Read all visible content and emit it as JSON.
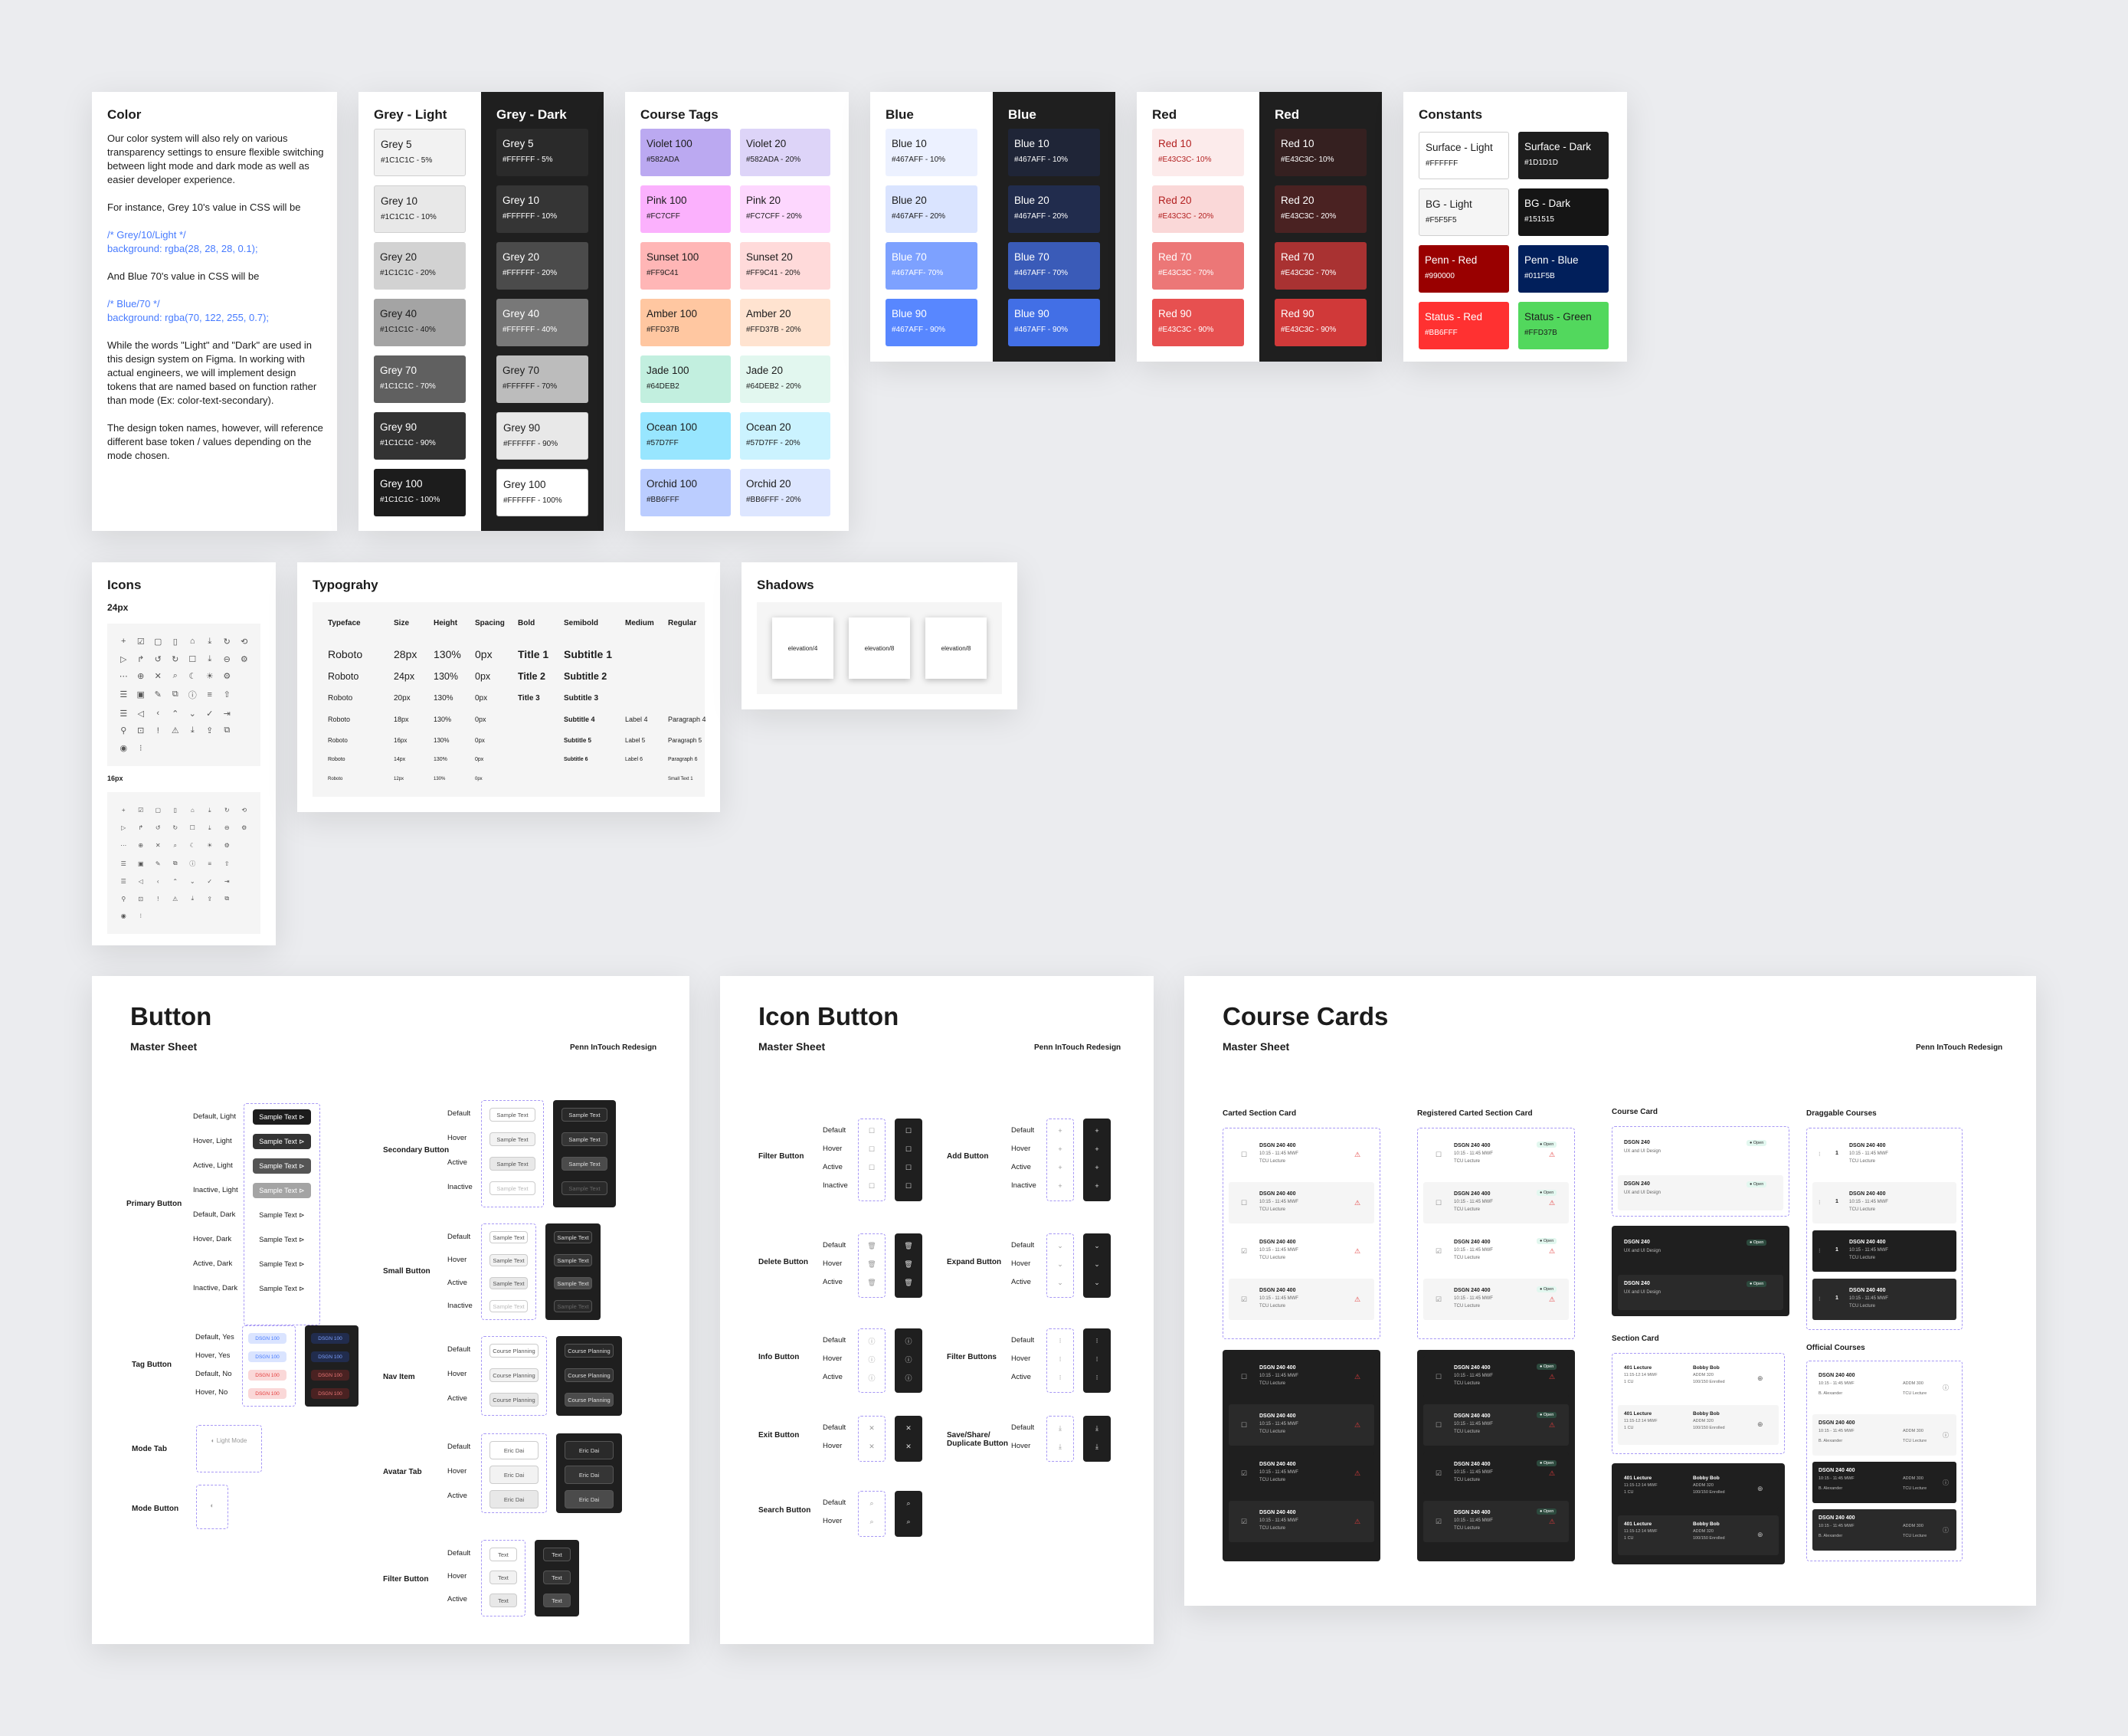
{
  "color_panel": {
    "title": "Color",
    "p1": "Our color system will also rely on various transparency settings to ensure flexible switching between light mode and dark mode as well as easier developer experience.",
    "p2": "For instance, Grey 10's value in CSS will be",
    "code1a": "/* Grey/10/Light */",
    "code1b": "background: rgba(28, 28, 28, 0.1);",
    "p3": "And Blue 70's value in CSS will be",
    "code2a": "/* Blue/70 */",
    "code2b": "background: rgba(70, 122, 255, 0.7);",
    "p4": "While the words \"Light\" and \"Dark\" are used in this design system on Figma. In working with actual engineers, we will implement design tokens that are named based on function rather than mode (Ex: color-text-secondary).",
    "p5": "The design token names, however, will reference different base token / values depending on the mode chosen."
  },
  "grey_light": {
    "title": "Grey - Light",
    "items": [
      {
        "n": "Grey 5",
        "v": "#1C1C1C - 5%",
        "bg": "#f2f2f2",
        "fg": "#1c1c1c"
      },
      {
        "n": "Grey 10",
        "v": "#1C1C1C - 10%",
        "bg": "#e8e8e8",
        "fg": "#1c1c1c"
      },
      {
        "n": "Grey 20",
        "v": "#1C1C1C - 20%",
        "bg": "#d2d2d2",
        "fg": "#1c1c1c"
      },
      {
        "n": "Grey 40",
        "v": "#1C1C1C - 40%",
        "bg": "#a4a4a4",
        "fg": "#1c1c1c"
      },
      {
        "n": "Grey 70",
        "v": "#1C1C1C - 70%",
        "bg": "#606060",
        "fg": "#ffffff"
      },
      {
        "n": "Grey 90",
        "v": "#1C1C1C - 90%",
        "bg": "#333333",
        "fg": "#ffffff"
      },
      {
        "n": "Grey 100",
        "v": "#1C1C1C - 100%",
        "bg": "#1c1c1c",
        "fg": "#ffffff"
      }
    ]
  },
  "grey_dark": {
    "title": "Grey - Dark",
    "items": [
      {
        "n": "Grey 5",
        "v": "#FFFFFF - 5%",
        "bg": "#2a2a2a",
        "fg": "#ffffff"
      },
      {
        "n": "Grey 10",
        "v": "#FFFFFF - 10%",
        "bg": "#353535",
        "fg": "#ffffff"
      },
      {
        "n": "Grey 20",
        "v": "#FFFFFF - 20%",
        "bg": "#4b4b4b",
        "fg": "#ffffff"
      },
      {
        "n": "Grey 40",
        "v": "#FFFFFF - 40%",
        "bg": "#787878",
        "fg": "#ffffff"
      },
      {
        "n": "Grey 70",
        "v": "#FFFFFF - 70%",
        "bg": "#bcbcbc",
        "fg": "#1c1c1c"
      },
      {
        "n": "Grey 90",
        "v": "#FFFFFF - 90%",
        "bg": "#e8e8e8",
        "fg": "#1c1c1c"
      },
      {
        "n": "Grey 100",
        "v": "#FFFFFF - 100%",
        "bg": "#ffffff",
        "fg": "#1c1c1c"
      }
    ]
  },
  "course_tags": {
    "title": "Course Tags",
    "items": [
      {
        "n": "Violet 100",
        "v": "#582ADA",
        "bg": "#bba9f1"
      },
      {
        "n": "Violet 20",
        "v": "#582ADA - 20%",
        "bg": "#ddd4f8"
      },
      {
        "n": "Pink 100",
        "v": "#FC7CFF",
        "bg": "#fbb1fd"
      },
      {
        "n": "Pink 20",
        "v": "#FC7CFF - 20%",
        "bg": "#fdd7fe"
      },
      {
        "n": "Sunset 100",
        "v": "#FF9C41",
        "bg": "#ffb6b6"
      },
      {
        "n": "Sunset 20",
        "v": "#FF9C41 - 20%",
        "bg": "#ffdada"
      },
      {
        "n": "Amber 100",
        "v": "#FFD37B",
        "bg": "#ffc7a1"
      },
      {
        "n": "Amber 20",
        "v": "#FFD37B - 20%",
        "bg": "#ffe3d0"
      },
      {
        "n": "Jade 100",
        "v": "#64DEB2",
        "bg": "#c2efdf"
      },
      {
        "n": "Jade 20",
        "v": "#64DEB2 - 20%",
        "bg": "#e2f7ef"
      },
      {
        "n": "Ocean 100",
        "v": "#57D7FF",
        "bg": "#98e6ff"
      },
      {
        "n": "Ocean 20",
        "v": "#57D7FF - 20%",
        "bg": "#cbf3ff"
      },
      {
        "n": "Orchid 100",
        "v": "#BB6FFF",
        "bg": "#bbcdff"
      },
      {
        "n": "Orchid 20",
        "v": "#BB6FFF - 20%",
        "bg": "#dde6ff"
      }
    ]
  },
  "blue_light": {
    "title": "Blue",
    "items": [
      {
        "n": "Blue 10",
        "v": "#467AFF - 10%",
        "bg": "#ecf1ff",
        "fg": "#1c1c1c"
      },
      {
        "n": "Blue 20",
        "v": "#467AFF - 20%",
        "bg": "#dae4ff",
        "fg": "#1c1c1c"
      },
      {
        "n": "Blue 70",
        "v": "#467AFF- 70%",
        "bg": "#7da1ff",
        "fg": "#ffffff"
      },
      {
        "n": "Blue 90",
        "v": "#467AFF - 90%",
        "bg": "#5887ff",
        "fg": "#ffffff"
      }
    ]
  },
  "blue_dark": {
    "title": "Blue",
    "items": [
      {
        "n": "Blue 10",
        "v": "#467AFF - 10%",
        "bg": "#1f2537",
        "fg": "#ffffff"
      },
      {
        "n": "Blue 20",
        "v": "#467AFF - 20%",
        "bg": "#212c4d",
        "fg": "#ffffff"
      },
      {
        "n": "Blue 70",
        "v": "#467AFF - 70%",
        "bg": "#3a5bb8",
        "fg": "#ffffff"
      },
      {
        "n": "Blue 90",
        "v": "#467AFF - 90%",
        "bg": "#426fe6",
        "fg": "#ffffff"
      }
    ]
  },
  "red_light": {
    "title": "Red",
    "items": [
      {
        "n": "Red 10",
        "v": "#E43C3C- 10%",
        "bg": "#fcebeb",
        "fg": "#b21f1f"
      },
      {
        "n": "Red 20",
        "v": "#E43C3C - 20%",
        "bg": "#fad8d8",
        "fg": "#b21f1f"
      },
      {
        "n": "Red 70",
        "v": "#E43C3C - 70%",
        "bg": "#ec7777",
        "fg": "#ffffff"
      },
      {
        "n": "Red 90",
        "v": "#E43C3C - 90%",
        "bg": "#e75050",
        "fg": "#ffffff"
      }
    ]
  },
  "red_dark": {
    "title": "Red",
    "items": [
      {
        "n": "Red 10",
        "v": "#E43C3C- 10%",
        "bg": "#352020",
        "fg": "#ffffff"
      },
      {
        "n": "Red 20",
        "v": "#E43C3C - 20%",
        "bg": "#4a2222",
        "fg": "#ffffff"
      },
      {
        "n": "Red 70",
        "v": "#E43C3C - 70%",
        "bg": "#a93232",
        "fg": "#ffffff"
      },
      {
        "n": "Red 90",
        "v": "#E43C3C - 90%",
        "bg": "#d03939",
        "fg": "#ffffff"
      }
    ]
  },
  "constants": {
    "title": "Constants",
    "items": [
      {
        "n": "Surface - Light",
        "v": "#FFFFFF",
        "bg": "#ffffff",
        "fg": "#1c1c1c"
      },
      {
        "n": "Surface - Dark",
        "v": "#1D1D1D",
        "bg": "#1d1d1d",
        "fg": "#ffffff"
      },
      {
        "n": "BG - Light",
        "v": "#F5F5F5",
        "bg": "#f5f5f5",
        "fg": "#1c1c1c"
      },
      {
        "n": "BG - Dark",
        "v": "#151515",
        "bg": "#151515",
        "fg": "#ffffff"
      },
      {
        "n": "Penn - Red",
        "v": "#990000",
        "bg": "#990000",
        "fg": "#ffffff"
      },
      {
        "n": "Penn - Blue",
        "v": "#011F5B",
        "bg": "#011f5b",
        "fg": "#ffffff"
      },
      {
        "n": "Status - Red",
        "v": "#BB6FFF",
        "bg": "#ff3131",
        "fg": "#ffffff"
      },
      {
        "n": "Status - Green",
        "v": "#FFD37B",
        "bg": "#52d85d",
        "fg": "#1c1c1c"
      }
    ]
  },
  "icons": {
    "title": "Icons",
    "size24": "24px",
    "size16": "16px"
  },
  "typography": {
    "title": "Typograhy",
    "headers": [
      "Typeface",
      "Size",
      "Height",
      "Spacing",
      "Bold",
      "Semibold",
      "Medium",
      "Regular"
    ],
    "rows": [
      [
        "Roboto",
        "28px",
        "130%",
        "0px",
        "Title 1",
        "Subtitle 1",
        "",
        ""
      ],
      [
        "Roboto",
        "24px",
        "130%",
        "0px",
        "Title 2",
        "Subtitle 2",
        "",
        ""
      ],
      [
        "Roboto",
        "20px",
        "130%",
        "0px",
        "Title 3",
        "Subtitle 3",
        "",
        ""
      ],
      [
        "Roboto",
        "18px",
        "130%",
        "0px",
        "",
        "Subtitle 4",
        "Label 4",
        "Paragraph 4"
      ],
      [
        "Roboto",
        "16px",
        "130%",
        "0px",
        "",
        "Subtitle 5",
        "Label 5",
        "Paragraph 5"
      ],
      [
        "Roboto",
        "14px",
        "130%",
        "0px",
        "",
        "Subtitle 6",
        "Label 6",
        "Paragraph 6"
      ],
      [
        "Roboto",
        "12px",
        "130%",
        "0px",
        "",
        "",
        "",
        "Small Text 1"
      ]
    ]
  },
  "shadows": {
    "title": "Shadows",
    "items": [
      "elevation/4",
      "elevation/8",
      "elevation/8"
    ]
  },
  "button_sheet": {
    "title": "Button",
    "sub": "Master Sheet",
    "brand": "Penn InTouch Redesign",
    "primary_label": "Primary Button",
    "primary_states": [
      "Default, Light",
      "Hover, Light",
      "Active, Light",
      "Inactive, Light",
      "Default, Dark",
      "Hover, Dark",
      "Active, Dark",
      "Inactive, Dark"
    ],
    "sample": "Sample Text",
    "tag_label": "Tag Button",
    "tag_states": [
      "Default, Yes",
      "Hover, Yes",
      "Default, No",
      "Hover, No"
    ],
    "tag_text": "DSGN 100",
    "mode_tab_label": "Mode Tab",
    "mode_tab_text": "Light Mode",
    "mode_btn_label": "Mode Button",
    "secondary_label": "Secondary Button",
    "small_label": "Small Button",
    "nav_label": "Nav Item",
    "nav_text": "Course Planning",
    "avatar_label": "Avatar Tab",
    "avatar_name": "Eric Dai",
    "avatar_id": "ID: 14249847",
    "filter_label": "Filter Button",
    "filter_text": "Text",
    "states4": [
      "Default",
      "Hover",
      "Active",
      "Inactive"
    ],
    "states3": [
      "Default",
      "Hover",
      "Active"
    ]
  },
  "icon_button_sheet": {
    "title": "Icon Button",
    "sub": "Master Sheet",
    "brand": "Penn InTouch Redesign",
    "groups": [
      {
        "label": "Filter Button",
        "states": [
          "Default",
          "Hover",
          "Active",
          "Inactive"
        ]
      },
      {
        "label": "Delete Button",
        "states": [
          "Default",
          "Hover",
          "Active"
        ]
      },
      {
        "label": "Info Button",
        "states": [
          "Default",
          "Hover",
          "Active"
        ]
      },
      {
        "label": "Exit Button",
        "states": [
          "Default",
          "Hover"
        ]
      },
      {
        "label": "Search Button",
        "states": [
          "Default",
          "Hover"
        ]
      },
      {
        "label": "Add Button",
        "states": [
          "Default",
          "Hover",
          "Active",
          "Inactive"
        ]
      },
      {
        "label": "Expand Button",
        "states": [
          "Default",
          "Hover",
          "Active"
        ]
      },
      {
        "label": "Filter Buttons",
        "states": [
          "Default",
          "Hover",
          "Active"
        ]
      },
      {
        "label": "Save/Share/ Duplicate Button",
        "states": [
          "Default",
          "Hover"
        ]
      }
    ]
  },
  "course_cards": {
    "title": "Course Cards",
    "sub": "Master Sheet",
    "brand": "Penn InTouch Redesign",
    "col1": "Carted Section Card",
    "col2": "Registered Carted Section Card",
    "col3": "Course Card",
    "col3b": "Section Card",
    "col4": "Draggable Courses",
    "col4b": "Official Courses",
    "course": "DSGN 240 400",
    "time": "10:15 - 11:45 MWF",
    "type": "TCU Lecture",
    "course_short": "DSGN 240",
    "course_desc": "UX and UI Design",
    "open": "Open",
    "sec": "401 Lecture",
    "sec_time": "11:15-12:14 MWF",
    "sec_cu": "1 CU",
    "prof": "Bobby Bob",
    "room": "ADDM 320",
    "enrolled": "100/150 Enrolled",
    "room2": "ADDM 300",
    "instructor": "B. Alexander",
    "num": "1"
  }
}
